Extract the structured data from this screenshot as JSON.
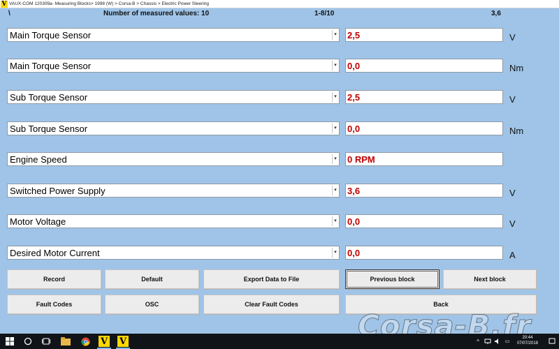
{
  "window": {
    "title": "VAUX-COM 120309a- Measuring Blocks> 1998 (W) > Corsa-B > Chassis > Electric Power Steering"
  },
  "header": {
    "backslash": "\\",
    "count_text": "Number of measured values: 10",
    "range_text": "1-8/10",
    "extra_value": "3,6"
  },
  "rows": [
    {
      "label": "Main Torque Sensor",
      "value": "2,5",
      "unit": "V"
    },
    {
      "label": "Main Torque Sensor",
      "value": "0,0",
      "unit": "Nm"
    },
    {
      "label": "Sub Torque Sensor",
      "value": "2,5",
      "unit": "V"
    },
    {
      "label": "Sub Torque Sensor",
      "value": "0,0",
      "unit": "Nm"
    },
    {
      "label": "Engine Speed",
      "value": "0 RPM",
      "unit": ""
    },
    {
      "label": "Switched Power Supply",
      "value": "3,6",
      "unit": "V"
    },
    {
      "label": "Motor Voltage",
      "value": "0,0",
      "unit": "V"
    },
    {
      "label": "Desired Motor Current",
      "value": "0,0",
      "unit": "A"
    }
  ],
  "buttons": {
    "record": "Record",
    "default": "Default",
    "export": "Export Data to File",
    "previous": "Previous block",
    "next": "Next block",
    "fault_codes": "Fault Codes",
    "osc": "OSC",
    "clear_fault_codes": "Clear Fault Codes",
    "back": "Back"
  },
  "taskbar": {
    "time": "20:44",
    "date": "07/07/2018"
  },
  "watermark": "Corsa-B.fr",
  "colors": {
    "background": "#9fc4e8",
    "value_text": "#c00000",
    "app_logo": "#ffd800"
  }
}
